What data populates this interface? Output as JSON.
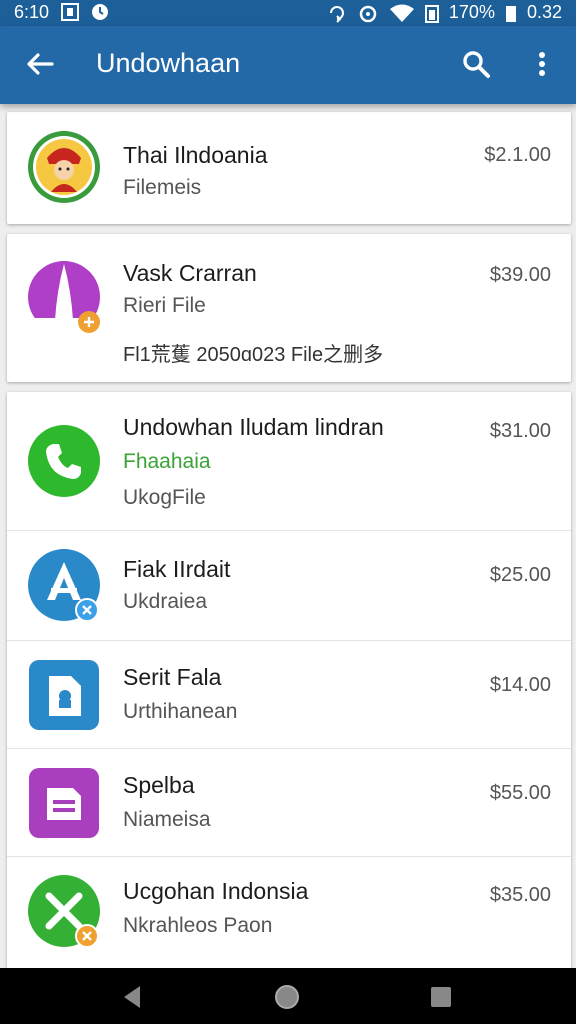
{
  "status_bar": {
    "time": "6:10",
    "battery_text": "170%",
    "extra_text": "0.32"
  },
  "app_bar": {
    "title": "Undowhaan",
    "icons": [
      "back-arrow-icon",
      "search-icon",
      "more-vert-icon"
    ]
  },
  "items": [
    {
      "name": "Thai Ilndoania",
      "sub": "Filemeis",
      "price": "$2.1.00",
      "icon": "indonesia-emblem-icon"
    },
    {
      "name": "Vask Crarran",
      "sub": "Rieri File",
      "extra": "Fl1荒蒦  2050ɑ023 File之删多",
      "price": "$39.00",
      "icon": "purple-pin-icon"
    },
    {
      "name": "Undowhan Iludam lindran",
      "sub": "Fhaahaia",
      "extra": "UkogFile",
      "price": "$31.00",
      "icon": "phone-icon"
    },
    {
      "name": "Fiak IIrdait",
      "sub": "Ukdraiea",
      "price": "$25.00",
      "icon": "app-store-icon"
    },
    {
      "name": "Serit Fala",
      "sub": "Urthihanean",
      "price": "$14.00",
      "icon": "blue-file-icon"
    },
    {
      "name": "Spelba",
      "sub": "Niameisa",
      "price": "$55.00",
      "icon": "purple-document-icon"
    },
    {
      "name": "Ucgohan Indonsia",
      "sub": "Nkrahleos Paon",
      "price": "$35.00",
      "icon": "green-x-icon"
    }
  ],
  "colors": {
    "status_bar": "#1d5f98",
    "app_bar": "#2369a8",
    "green_text": "#3aa336"
  }
}
